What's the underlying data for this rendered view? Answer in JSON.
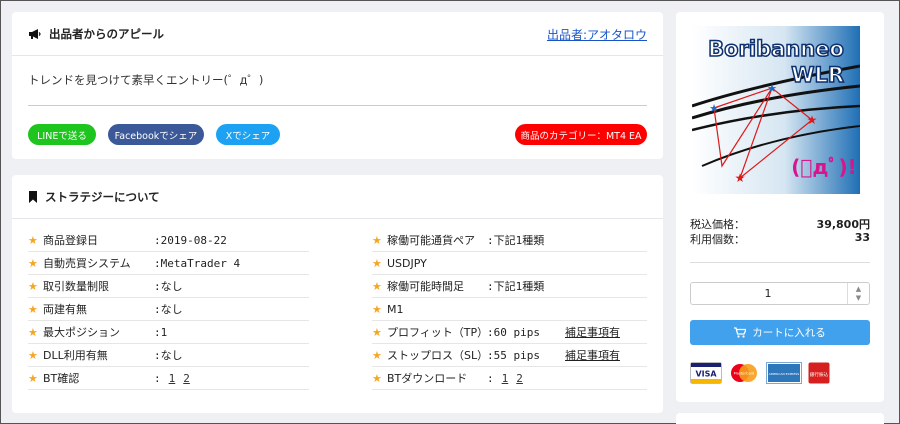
{
  "appeal": {
    "header_title": "出品者からのアピール",
    "seller_link": "出品者:アオタロウ",
    "text": "トレンドを見つけて素早くエントリー(゜д゜)",
    "line_btn": "LINEで送る",
    "facebook_btn": "Facebookでシェア",
    "x_btn": "Xでシェア",
    "category_btn": "商品のカテゴリー：MT4 EA"
  },
  "strategy": {
    "header_title": "ストラテジーについて",
    "left": [
      {
        "label": "商品登録日",
        "value": ":2019-08-22"
      },
      {
        "label": "自動売買システム",
        "value": ":MetaTrader 4"
      },
      {
        "label": "取引数量制限",
        "value": ":なし"
      },
      {
        "label": "両建有無",
        "value": ":なし"
      },
      {
        "label": "最大ポジション",
        "value": ":1"
      },
      {
        "label": "DLL利用有無",
        "value": ":なし"
      },
      {
        "label": "BT確認",
        "value": ":",
        "links": [
          "1",
          "2"
        ]
      }
    ],
    "right": [
      {
        "label": "稼働可能通貨ペア",
        "value": ":下記1種類"
      },
      {
        "label": "USDJPY",
        "value": ""
      },
      {
        "label": "稼働可能時間足",
        "value": ":下記1種類"
      },
      {
        "label": "M1",
        "value": ""
      },
      {
        "label": "プロフィット（TP）",
        "value": ":60 pips",
        "note": "補足事項有"
      },
      {
        "label": "ストップロス（SL）",
        "value": ":55 pips",
        "note": "補足事項有"
      },
      {
        "label": "BTダウンロード",
        "value": ":",
        "links": [
          "1",
          "2"
        ]
      }
    ]
  },
  "product": {
    "image_title_line1": "Boribanneo",
    "image_title_line2": "WLR",
    "image_face": "(ﾟдﾟ)!",
    "price_label": "税込価格：",
    "price_value": "39,800円",
    "users_label": "利用個数：",
    "users_value": "33",
    "quantity": "1",
    "cart_label": "カートに入れる",
    "payments": [
      "VISA",
      "MasterCard",
      "AMERICAN EXPRESS",
      "銀行振込"
    ]
  },
  "colors": {
    "link": "#1a55c8",
    "line": "#1ec51e",
    "facebook": "#3b5998",
    "x": "#1da1f2",
    "category": "#ff0000",
    "cart": "#42a1ec",
    "star": "#f5a623"
  }
}
